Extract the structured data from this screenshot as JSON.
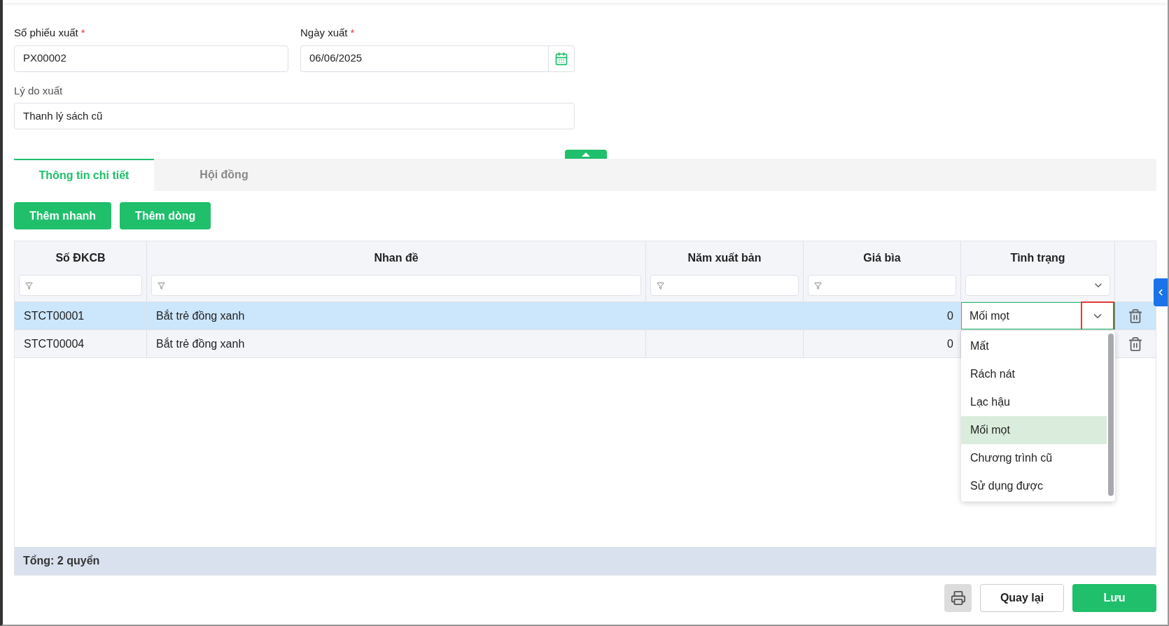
{
  "form": {
    "fields": [
      {
        "label": "Số phiếu xuất",
        "required_mark": "*",
        "value": "PX00002",
        "kind": "text"
      },
      {
        "label": "Ngày xuất",
        "required_mark": "*",
        "value": "06/06/2025",
        "kind": "date"
      },
      {
        "label": "Lý do xuất",
        "value": "Thanh lý sách cũ",
        "kind": "text"
      }
    ]
  },
  "tabs": [
    {
      "label": "Thông tin chi tiết",
      "selected": true
    },
    {
      "label": "Hội đồng",
      "selected": false
    }
  ],
  "actions": [
    "Thêm nhanh",
    "Thêm dòng"
  ],
  "table": {
    "columns": [
      {
        "label": "Số ĐKCB",
        "kind": "text"
      },
      {
        "label": "Nhan đề",
        "kind": "text"
      },
      {
        "label": "Năm xuất bản",
        "kind": "text"
      },
      {
        "label": "Giá bìa",
        "kind": "text"
      },
      {
        "label": "Tình trạng",
        "kind": "select"
      }
    ],
    "rows": [
      {
        "selected": true,
        "so_dkcb": "STCT00001",
        "nhan_de": "Bắt trẻ đồng xanh",
        "gia_bia": "0",
        "tinh_trang": "Mối mọt",
        "dropdown_open": true,
        "toggle_highlighted": true
      },
      {
        "selected": false,
        "so_dkcb": "STCT00004",
        "nhan_de": "Bắt trẻ đồng xanh",
        "gia_bia": "0",
        "dropdown_open": false
      }
    ],
    "dropdown_options": [
      {
        "label": "Mất",
        "selected": false
      },
      {
        "label": "Rách nát",
        "selected": false
      },
      {
        "label": "Lạc hậu",
        "selected": false
      },
      {
        "label": "Mối mọt",
        "selected": true
      },
      {
        "label": "Chương trình cũ",
        "selected": false
      },
      {
        "label": "Sử dụng được",
        "selected": false
      }
    ],
    "footer": "Tổng: 2 quyển"
  },
  "bottom_buttons": [
    {
      "kind": "print"
    },
    {
      "kind": "secondary",
      "label": "Quay lại"
    },
    {
      "kind": "primary",
      "label": "Lưu"
    }
  ]
}
